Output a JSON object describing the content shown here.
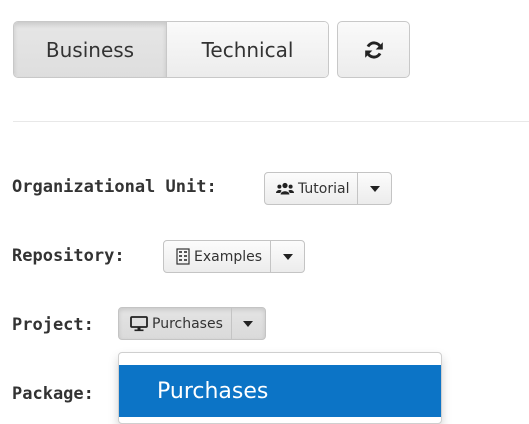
{
  "toolbar": {
    "business_label": "Business",
    "technical_label": "Technical",
    "refresh_icon": "refresh-icon"
  },
  "form": {
    "organizational_unit": {
      "label": "Organizational Unit:",
      "value": "Tutorial",
      "icon": "group-icon"
    },
    "repository": {
      "label": "Repository:",
      "value": "Examples",
      "icon": "repository-icon"
    },
    "project": {
      "label": "Project:",
      "value": "Purchases",
      "icon": "desktop-icon"
    },
    "package": {
      "label": "Package:"
    }
  },
  "dropdown": {
    "items": [
      {
        "label": "Purchases",
        "highlighted": true
      }
    ]
  },
  "colors": {
    "highlight": "#0c74c6",
    "text": "#333333"
  }
}
